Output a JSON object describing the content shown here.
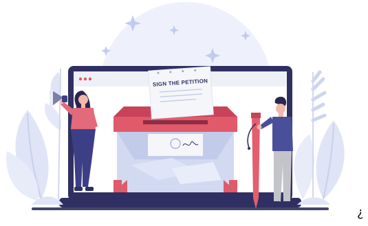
{
  "illustration": {
    "paper_heading": "SIGN THE PETITION",
    "trailing_mark": "¿",
    "colors": {
      "sky_circle": "#eef1fb",
      "laptop_frame": "#2f3061",
      "screen": "#ffffff",
      "screen_bar": "#eef0f7",
      "ballot_box": "#e05a6a",
      "ballot_box_dark": "#c8435a",
      "ballot_box_glass": "#c9d3ee",
      "paper": "#f5f6fa",
      "woman_top": "#e36a7a",
      "woman_pants": "#3d3f86",
      "man_jacket": "#4a4f9a",
      "man_pants": "#c3c4c9",
      "pen": "#e35e6e",
      "leaves": "#dfe4f6",
      "sparkle": "#c2cbee"
    }
  }
}
